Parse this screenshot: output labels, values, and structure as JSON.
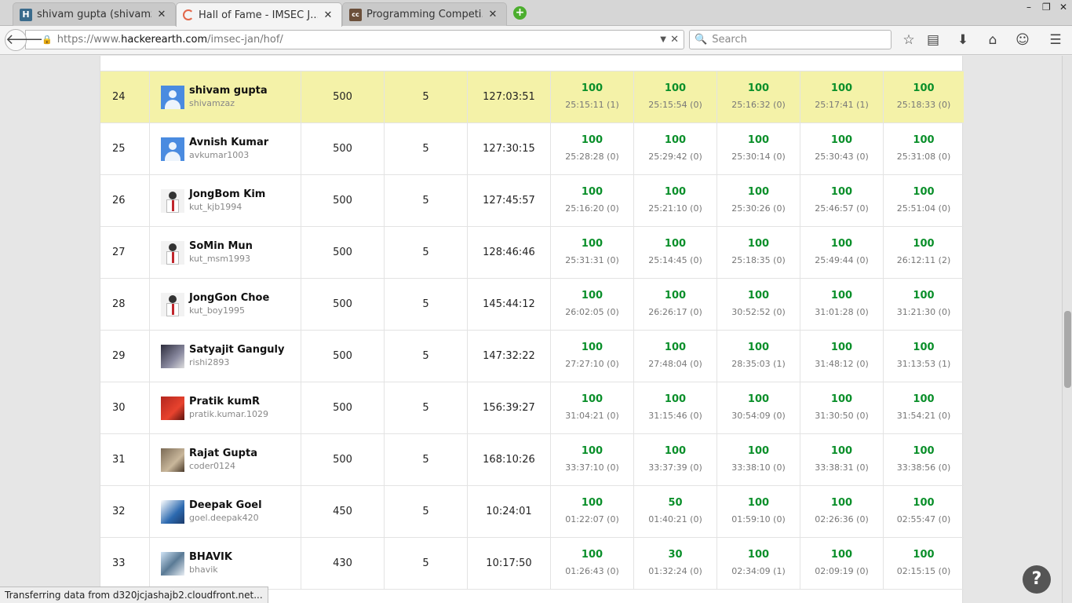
{
  "browser": {
    "tabs": [
      {
        "title": "shivam gupta (shivamz...",
        "icon": "hackerearth-icon",
        "active": false
      },
      {
        "title": "Hall of Fame - IMSEC J...",
        "icon": "loading-icon",
        "active": true
      },
      {
        "title": "Programming Competi...",
        "icon": "codechef-icon",
        "active": false
      }
    ],
    "url_prefix": "https://www.",
    "url_host": "hackerearth.com",
    "url_path": "/imsec-jan/hof/",
    "search_placeholder": "Search",
    "status_text": "Transferring data from d320jcjashajb2.cloudfront.net..."
  },
  "leaderboard": {
    "rows": [
      {
        "rank": "24",
        "name": "shivam gupta",
        "handle": "shivamzaz",
        "score": "500",
        "solved": "5",
        "time": "127:03:51",
        "highlight": true,
        "problems": [
          {
            "score": "100",
            "time": "25:15:11 (1)"
          },
          {
            "score": "100",
            "time": "25:15:54 (0)"
          },
          {
            "score": "100",
            "time": "25:16:32 (0)"
          },
          {
            "score": "100",
            "time": "25:17:41 (1)"
          },
          {
            "score": "100",
            "time": "25:18:33 (0)"
          }
        ]
      },
      {
        "rank": "25",
        "name": "Avnish Kumar",
        "handle": "avkumar1003",
        "score": "500",
        "solved": "5",
        "time": "127:30:15",
        "problems": [
          {
            "score": "100",
            "time": "25:28:28 (0)"
          },
          {
            "score": "100",
            "time": "25:29:42 (0)"
          },
          {
            "score": "100",
            "time": "25:30:14 (0)"
          },
          {
            "score": "100",
            "time": "25:30:43 (0)"
          },
          {
            "score": "100",
            "time": "25:31:08 (0)"
          }
        ]
      },
      {
        "rank": "26",
        "name": "JongBom Kim",
        "handle": "kut_kjb1994",
        "score": "500",
        "solved": "5",
        "time": "127:45:57",
        "problems": [
          {
            "score": "100",
            "time": "25:16:20 (0)"
          },
          {
            "score": "100",
            "time": "25:21:10 (0)"
          },
          {
            "score": "100",
            "time": "25:30:26 (0)"
          },
          {
            "score": "100",
            "time": "25:46:57 (0)"
          },
          {
            "score": "100",
            "time": "25:51:04 (0)"
          }
        ]
      },
      {
        "rank": "27",
        "name": "SoMin Mun",
        "handle": "kut_msm1993",
        "score": "500",
        "solved": "5",
        "time": "128:46:46",
        "problems": [
          {
            "score": "100",
            "time": "25:31:31 (0)"
          },
          {
            "score": "100",
            "time": "25:14:45 (0)"
          },
          {
            "score": "100",
            "time": "25:18:35 (0)"
          },
          {
            "score": "100",
            "time": "25:49:44 (0)"
          },
          {
            "score": "100",
            "time": "26:12:11 (2)"
          }
        ]
      },
      {
        "rank": "28",
        "name": "JongGon Choe",
        "handle": "kut_boy1995",
        "score": "500",
        "solved": "5",
        "time": "145:44:12",
        "problems": [
          {
            "score": "100",
            "time": "26:02:05 (0)"
          },
          {
            "score": "100",
            "time": "26:26:17 (0)"
          },
          {
            "score": "100",
            "time": "30:52:52 (0)"
          },
          {
            "score": "100",
            "time": "31:01:28 (0)"
          },
          {
            "score": "100",
            "time": "31:21:30 (0)"
          }
        ]
      },
      {
        "rank": "29",
        "name": "Satyajit Ganguly",
        "handle": "rishi2893",
        "score": "500",
        "solved": "5",
        "time": "147:32:22",
        "problems": [
          {
            "score": "100",
            "time": "27:27:10 (0)"
          },
          {
            "score": "100",
            "time": "27:48:04 (0)"
          },
          {
            "score": "100",
            "time": "28:35:03 (1)"
          },
          {
            "score": "100",
            "time": "31:48:12 (0)"
          },
          {
            "score": "100",
            "time": "31:13:53 (1)"
          }
        ]
      },
      {
        "rank": "30",
        "name": "Pratik kumR",
        "handle": "pratik.kumar.1029",
        "score": "500",
        "solved": "5",
        "time": "156:39:27",
        "problems": [
          {
            "score": "100",
            "time": "31:04:21 (0)"
          },
          {
            "score": "100",
            "time": "31:15:46 (0)"
          },
          {
            "score": "100",
            "time": "30:54:09 (0)"
          },
          {
            "score": "100",
            "time": "31:30:50 (0)"
          },
          {
            "score": "100",
            "time": "31:54:21 (0)"
          }
        ]
      },
      {
        "rank": "31",
        "name": "Rajat Gupta",
        "handle": "coder0124",
        "score": "500",
        "solved": "5",
        "time": "168:10:26",
        "problems": [
          {
            "score": "100",
            "time": "33:37:10 (0)"
          },
          {
            "score": "100",
            "time": "33:37:39 (0)"
          },
          {
            "score": "100",
            "time": "33:38:10 (0)"
          },
          {
            "score": "100",
            "time": "33:38:31 (0)"
          },
          {
            "score": "100",
            "time": "33:38:56 (0)"
          }
        ]
      },
      {
        "rank": "32",
        "name": "Deepak Goel",
        "handle": "goel.deepak420",
        "score": "450",
        "solved": "5",
        "time": "10:24:01",
        "problems": [
          {
            "score": "100",
            "time": "01:22:07 (0)"
          },
          {
            "score": "50",
            "time": "01:40:21 (0)"
          },
          {
            "score": "100",
            "time": "01:59:10 (0)"
          },
          {
            "score": "100",
            "time": "02:26:36 (0)"
          },
          {
            "score": "100",
            "time": "02:55:47 (0)"
          }
        ]
      },
      {
        "rank": "33",
        "name": "BHAVIK",
        "handle": "bhavik",
        "score": "430",
        "solved": "5",
        "time": "10:17:50",
        "problems": [
          {
            "score": "100",
            "time": "01:26:43 (0)"
          },
          {
            "score": "30",
            "time": "01:32:24 (0)"
          },
          {
            "score": "100",
            "time": "02:34:09 (1)"
          },
          {
            "score": "100",
            "time": "02:09:19 (0)"
          },
          {
            "score": "100",
            "time": "02:15:15 (0)"
          }
        ]
      }
    ]
  }
}
